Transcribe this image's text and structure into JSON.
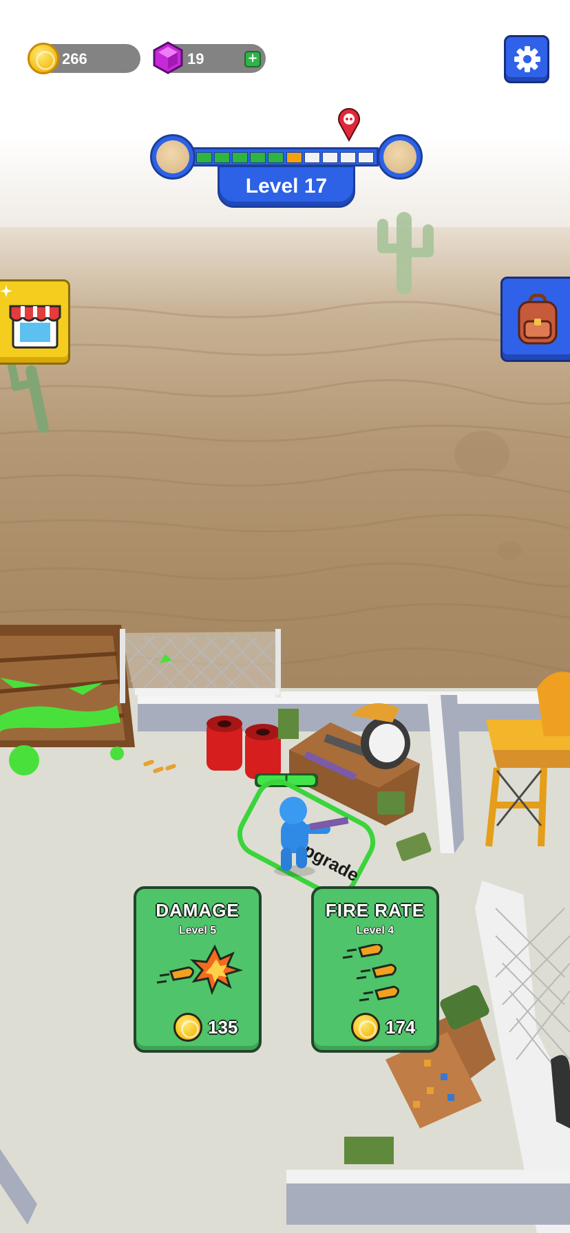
{
  "hud": {
    "coins": "266",
    "gems": "19",
    "plus_label": "+",
    "level_label": "Level 17",
    "progress": {
      "total_segments": 10,
      "completed_segments": 5,
      "current_segment": 6,
      "completed_color": "#2fb53f",
      "current_color": "#f5a20a",
      "remaining_color": "#f2f2f2"
    }
  },
  "icons": {
    "coin": "coin-icon",
    "gem": "gem-icon",
    "settings": "gear-icon",
    "shop": "shop-icon",
    "backpack": "backpack-icon",
    "boss": "skull-pin-icon"
  },
  "zone": {
    "label": "Upgrade"
  },
  "cards": [
    {
      "title": "DAMAGE",
      "level": "Level 5",
      "cost": "135",
      "icon": "bullet-explosion-icon"
    },
    {
      "title": "FIRE RATE",
      "level": "Level 4",
      "cost": "174",
      "icon": "bullets-icon"
    }
  ],
  "colors": {
    "accent_blue": "#2f62e8",
    "card_green": "#4fc46a",
    "shop_yellow": "#f4cd1f",
    "zone_green": "#3ad43c"
  }
}
